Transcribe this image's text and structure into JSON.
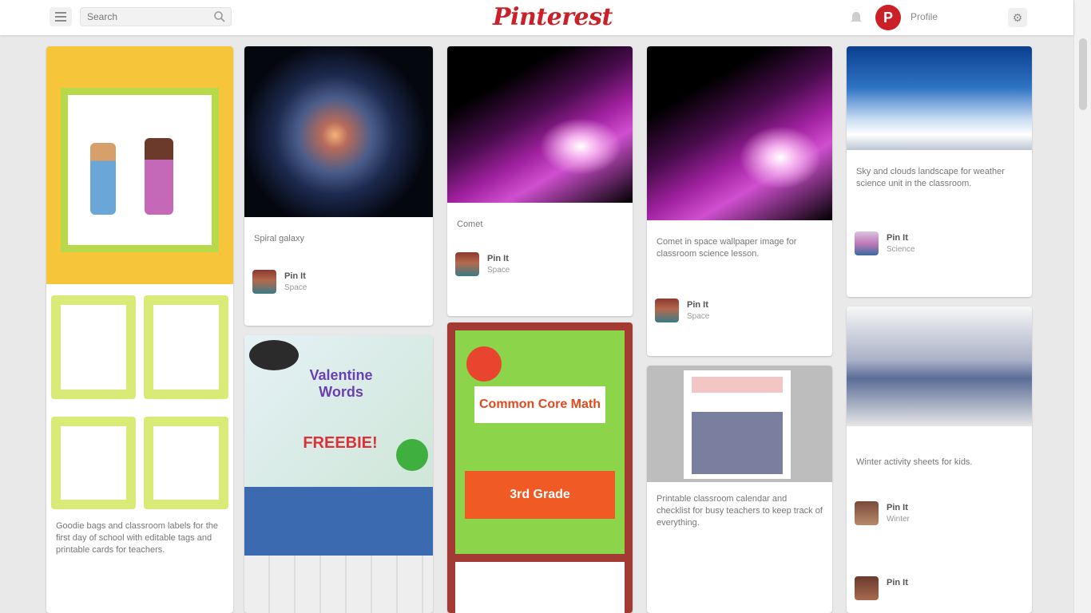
{
  "header": {
    "search_placeholder": "Search",
    "logo": "Pinterest",
    "user_initial": "P",
    "user_name": "Profile",
    "settings_glyph": "⚙"
  },
  "icons": {
    "menu": "menu-icon",
    "search": "search-icon",
    "bell": "notification-icon",
    "settings": "gear-icon"
  },
  "colors": {
    "brand": "#cb2027",
    "background": "#e9e9e9"
  },
  "pins": {
    "col1": {
      "desc": "Goodie bags and classroom labels for the first day of school with editable tags and printable cards for teachers."
    },
    "col2a": {
      "desc": "Spiral galaxy",
      "pinner": "Pin It",
      "board": "Space"
    },
    "col2b": {
      "title": "Valentine Words",
      "banner": "FREEBIE!"
    },
    "col3a": {
      "desc": "Comet",
      "pinner": "Pin It",
      "board": "Space"
    },
    "col3b": {
      "title": "Common Core Math",
      "banner": "3rd Grade"
    },
    "col4a": {
      "desc": "Comet in space wallpaper image for classroom science lesson.",
      "pinner": "Pin It",
      "board": "Space"
    },
    "col4b": {
      "desc": "Printable classroom calendar and checklist for busy teachers to keep track of everything."
    },
    "col5a": {
      "desc": "Sky and clouds landscape for weather science unit in the classroom.",
      "pinner": "Pin It",
      "board": "Science"
    },
    "col5b": {
      "desc": "Winter activity sheets for kids.",
      "pinner": "Pin It",
      "board": "Winter",
      "pinner2": "Pin It"
    }
  }
}
